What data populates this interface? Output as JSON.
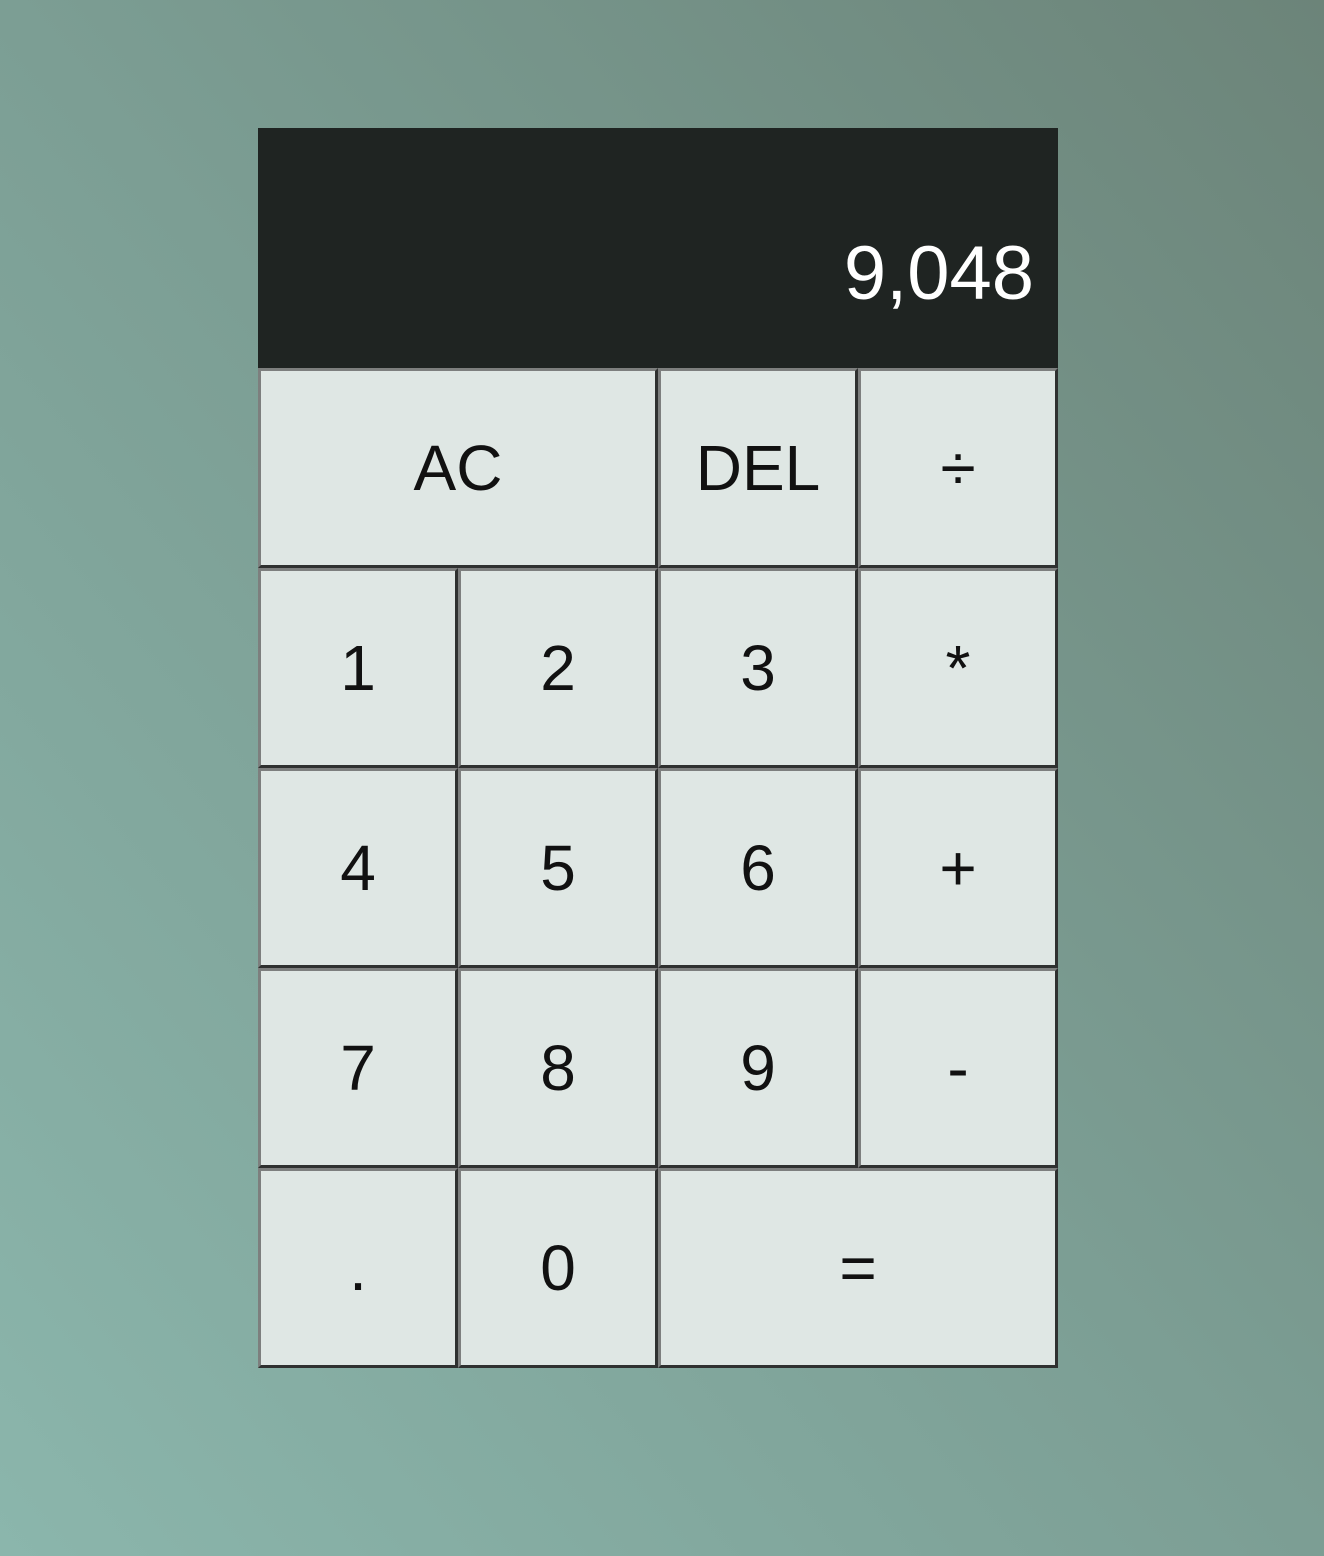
{
  "display": {
    "previous_operand": "",
    "current_operand": "9,048"
  },
  "keys": {
    "ac": "AC",
    "del": "DEL",
    "divide": "÷",
    "one": "1",
    "two": "2",
    "three": "3",
    "multiply": "*",
    "four": "4",
    "five": "5",
    "six": "6",
    "plus": "+",
    "seven": "7",
    "eight": "8",
    "nine": "9",
    "minus": "-",
    "decimal": ".",
    "zero": "0",
    "equals": "="
  },
  "colors": {
    "display_background": "#1f2422",
    "display_text": "#ffffff",
    "key_background": "#dfe7e4",
    "key_text": "#111111"
  }
}
